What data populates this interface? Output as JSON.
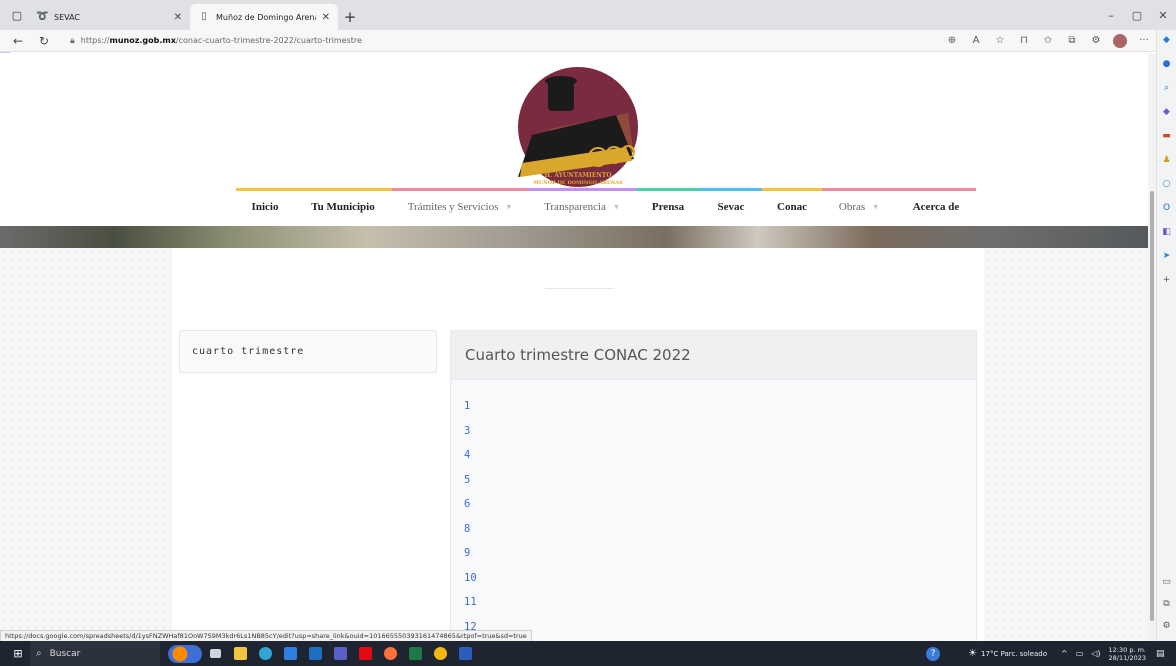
{
  "browser": {
    "tabs": [
      {
        "title": "SEVAC",
        "favicon": "ribbon-icon",
        "active": false
      },
      {
        "title": "Muñoz de Domingo Arenas",
        "favicon": "page-icon",
        "active": true
      }
    ],
    "address": {
      "scheme": "https://",
      "domain": "munoz.gob.mx",
      "path": "/conac-cuarto-trimestre-2022/cuarto-trimestre"
    },
    "status_url": "https://docs.google.com/spreadsheets/d/1ysFNZWHaf81OoW7S9M3kdr6Ls1NB85cY/edit?usp=share_link&ouid=101665550393161474865&rtpof=true&sd=true"
  },
  "logo": {
    "line1": "H. AYUNTAMIENTO",
    "line2": "MUÑOZ DE DOMINGO ARENAS",
    "line3": "2021-2024"
  },
  "nav": {
    "items": [
      {
        "label": "Inicio",
        "color": "#f6c244",
        "dropdown": false,
        "bold": true
      },
      {
        "label": "Tu Municipio",
        "color": "#f6c244",
        "dropdown": false,
        "bold": true
      },
      {
        "label": "Trámites y Servicios",
        "color": "#f08aa0",
        "dropdown": true,
        "bold": false
      },
      {
        "label": "Transparencia",
        "color": "#c58ef5",
        "dropdown": true,
        "bold": false
      },
      {
        "label": "Prensa",
        "color": "#4ccfa6",
        "dropdown": false,
        "bold": true
      },
      {
        "label": "Sevac",
        "color": "#4fc0f0",
        "dropdown": false,
        "bold": true
      },
      {
        "label": "Conac",
        "color": "#f6c244",
        "dropdown": false,
        "bold": true
      },
      {
        "label": "Obras",
        "color": "#f08aa0",
        "dropdown": true,
        "bold": false
      },
      {
        "label": "Acerca de",
        "color": "#f08aa0",
        "dropdown": false,
        "bold": true
      }
    ]
  },
  "sidebar": {
    "title": "cuarto trimestre"
  },
  "main": {
    "heading": "Cuarto trimestre CONAC 2022",
    "links": [
      "1",
      "3",
      "4",
      "5",
      "6",
      "8",
      "9",
      "10",
      "11",
      "12"
    ]
  },
  "taskbar": {
    "search_label": "Buscar",
    "weather": "17°C  Parc. soleado",
    "time": "12:30 p. m.",
    "date": "28/11/2023"
  },
  "colors": {
    "link": "#3d6ae0",
    "logo_maroon": "#7a2b3f",
    "logo_gold": "#d8a72b"
  }
}
